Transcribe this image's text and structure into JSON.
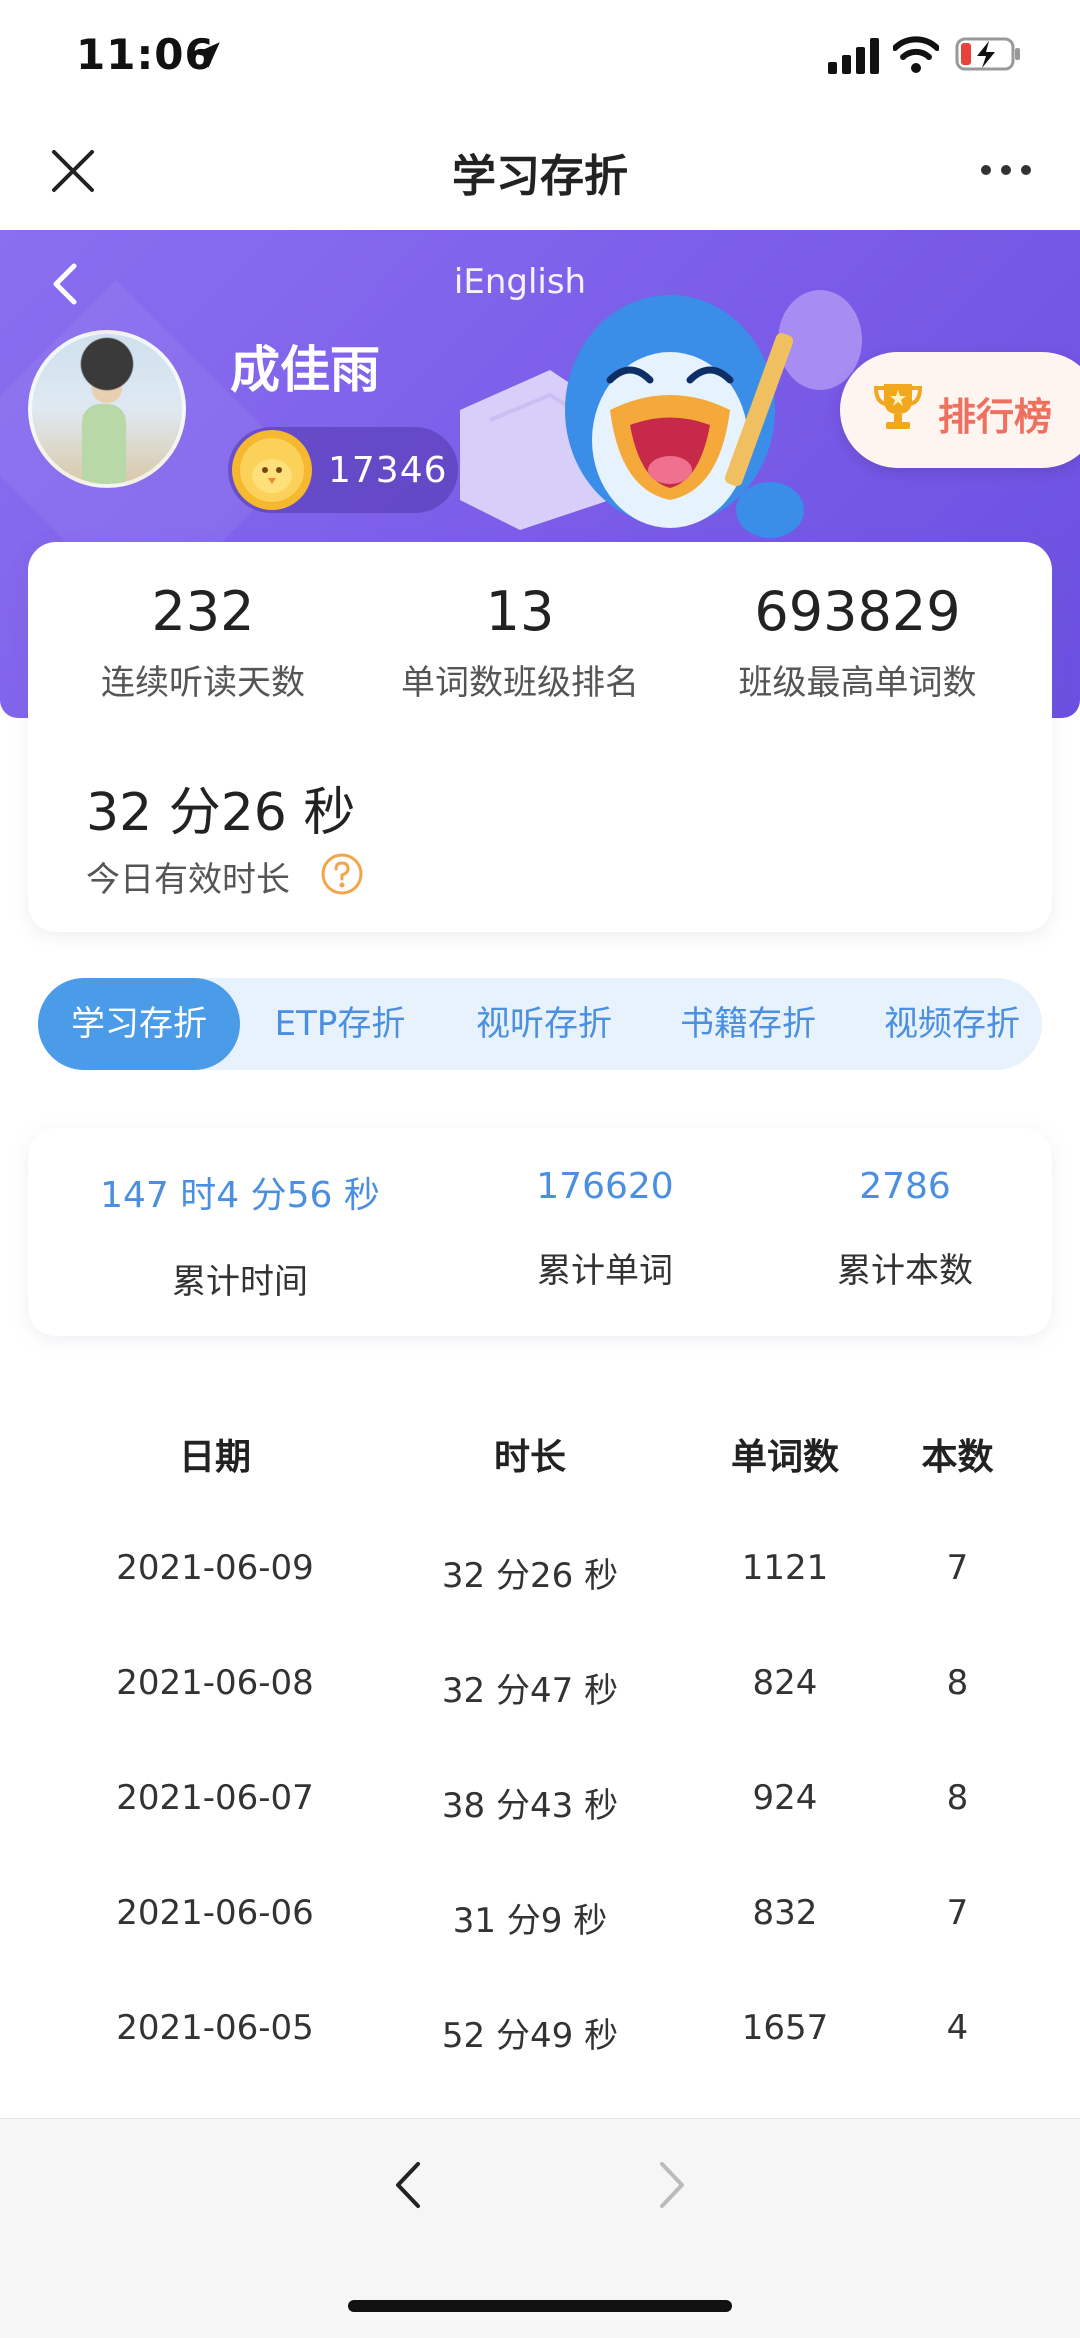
{
  "status": {
    "time": "11:06"
  },
  "nav": {
    "title": "学习存折"
  },
  "header": {
    "brand": "iEnglish",
    "user_name": "成佳雨",
    "coins": "17346",
    "rank_label": "排行榜"
  },
  "stats": [
    {
      "value": "232",
      "label": "连续听读天数"
    },
    {
      "value": "13",
      "label": "单词数班级排名"
    },
    {
      "value": "693829",
      "label": "班级最高单词数"
    }
  ],
  "today": {
    "value": "32 分26 秒",
    "label": "今日有效时长"
  },
  "tabs": [
    {
      "label": "学习存折",
      "active": true
    },
    {
      "label": "ETP存折",
      "active": false
    },
    {
      "label": "视听存折",
      "active": false
    },
    {
      "label": "书籍存折",
      "active": false
    },
    {
      "label": "视频存折",
      "active": false
    }
  ],
  "totals": [
    {
      "value": "147 时4 分56 秒",
      "label": "累计时间"
    },
    {
      "value": "176620",
      "label": "累计单词"
    },
    {
      "value": "2786",
      "label": "累计本数"
    }
  ],
  "table": {
    "headers": [
      "日期",
      "时长",
      "单词数",
      "本数"
    ],
    "rows": [
      [
        "2021-06-09",
        "32 分26 秒",
        "1121",
        "7"
      ],
      [
        "2021-06-08",
        "32 分47 秒",
        "824",
        "8"
      ],
      [
        "2021-06-07",
        "38 分43 秒",
        "924",
        "8"
      ],
      [
        "2021-06-06",
        "31 分9 秒",
        "832",
        "7"
      ],
      [
        "2021-06-05",
        "52 分49 秒",
        "1657",
        "4"
      ]
    ]
  },
  "colors": {
    "accent": "#4a9be8",
    "header": "#7a5ce8",
    "rank": "#f07060"
  }
}
